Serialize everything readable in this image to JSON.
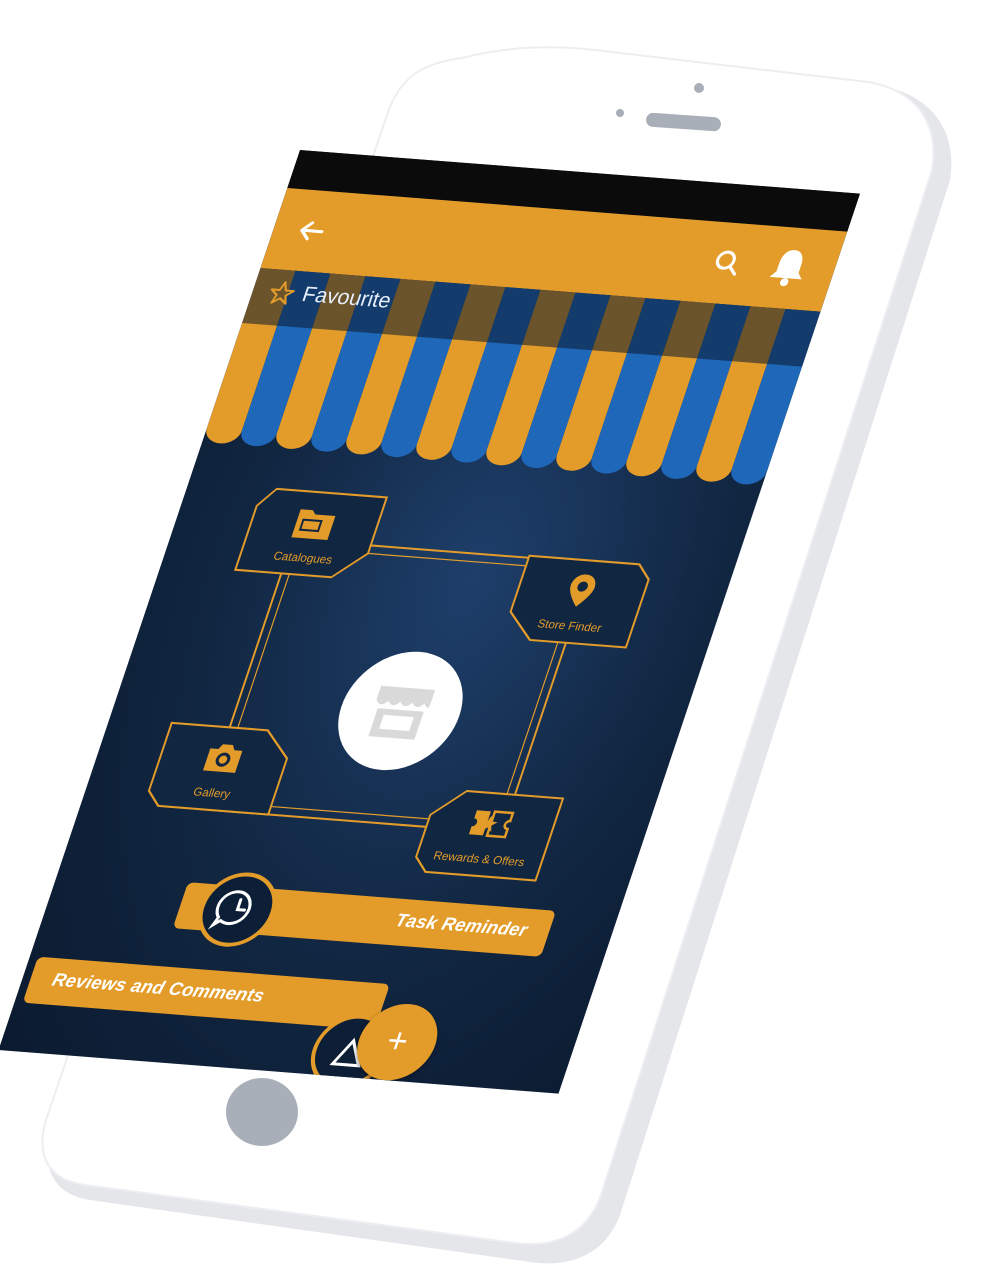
{
  "colors": {
    "accent": "#e39c2a",
    "stripe_blue": "#1f67b8",
    "screen_bg": "#112641",
    "status_bar": "#0b0b0b"
  },
  "toolbar": {
    "back_icon": "arrow-left-icon",
    "search_icon": "search-icon",
    "bell_icon": "bell-icon"
  },
  "favourite": {
    "label": "Favourite",
    "icon": "star-outline-icon"
  },
  "hub": {
    "center_icon": "store-icon",
    "tiles": [
      {
        "label": "Catalogues",
        "icon": "folder-icon"
      },
      {
        "label": "Store Finder",
        "icon": "location-pin-icon"
      },
      {
        "label": "Gallery",
        "icon": "camera-icon"
      },
      {
        "label": "Rewards & Offers",
        "icon": "ticket-star-icon"
      }
    ]
  },
  "actions": {
    "task_reminder": {
      "label": "Task Reminder",
      "icon": "clock-chat-icon"
    },
    "reviews": {
      "label": "Reviews and Comments",
      "icon": "review-icon"
    },
    "fab": {
      "label": "+",
      "icon": "plus-icon"
    }
  }
}
